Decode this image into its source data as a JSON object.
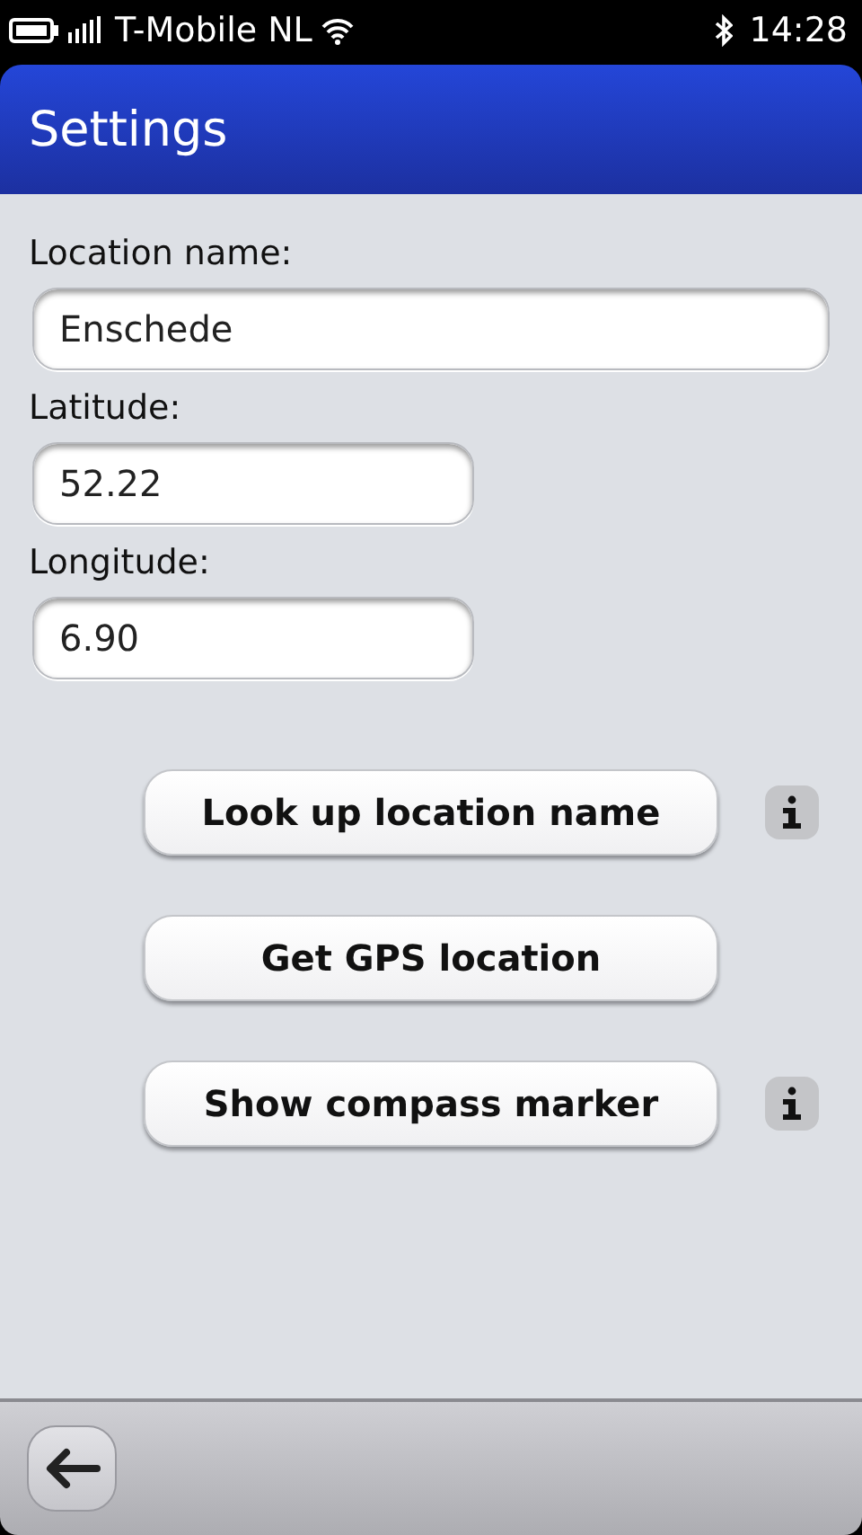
{
  "status_bar": {
    "carrier": "T-Mobile  NL",
    "time": "14:28"
  },
  "header": {
    "title": "Settings"
  },
  "fields": [
    {
      "label": "Location name:",
      "value": "Enschede"
    },
    {
      "label": "Latitude:",
      "value": "52.22"
    },
    {
      "label": "Longitude:",
      "value": "6.90"
    }
  ],
  "buttons": [
    {
      "label": "Look up location name",
      "info": true
    },
    {
      "label": "Get GPS location",
      "info": false
    },
    {
      "label": "Show compass marker",
      "info": true
    }
  ]
}
